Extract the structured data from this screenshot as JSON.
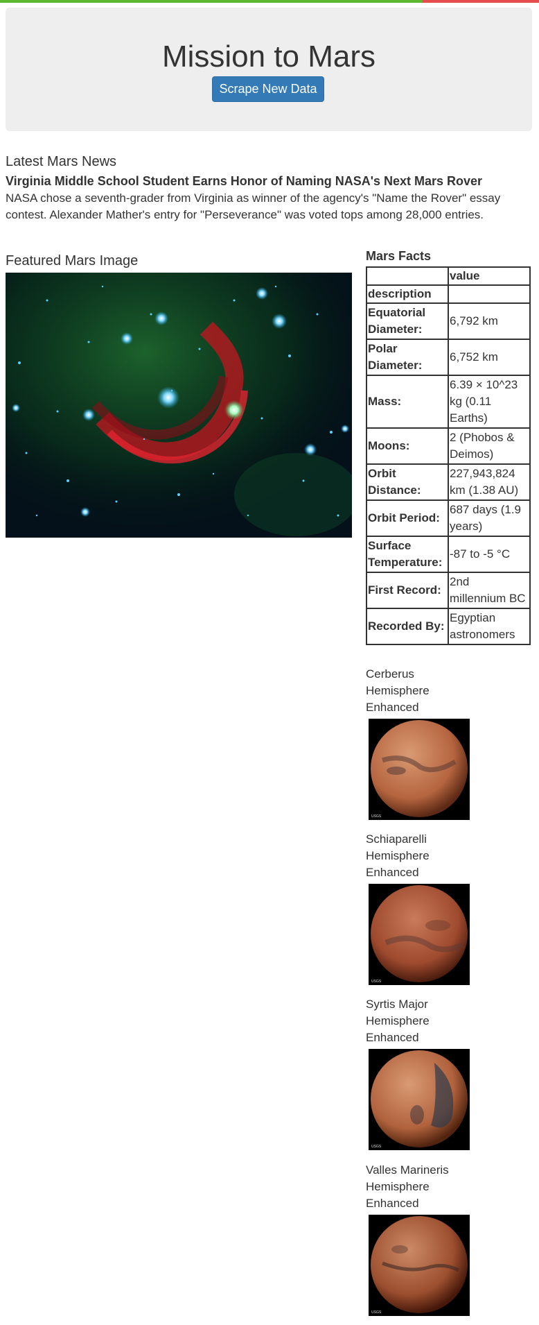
{
  "colors": {
    "top_bar_left": "#5cb82e",
    "top_bar_right": "#e74c4c",
    "jumbotron_bg": "#eeeeee",
    "button_bg": "#337ab7",
    "text": "#333333"
  },
  "header": {
    "title": "Mission to Mars",
    "scrape_button_label": "Scrape New Data"
  },
  "news": {
    "heading": "Latest Mars News",
    "title": "Virginia Middle School Student Earns Honor of Naming NASA's Next Mars Rover",
    "paragraph": "NASA chose a seventh-grader from Virginia as winner of the agency's \"Name the Rover\" essay contest. Alexander Mather's entry for \"Perseverance\" was voted tops among 28,000 entries."
  },
  "featured": {
    "heading": "Featured Mars Image"
  },
  "facts": {
    "heading": "Mars Facts",
    "column_header": "value",
    "index_label": "description",
    "rows": [
      {
        "label": "Equatorial Diameter:",
        "value": "6,792 km"
      },
      {
        "label": "Polar Diameter:",
        "value": "6,752 km"
      },
      {
        "label": "Mass:",
        "value": "6.39 × 10^23 kg (0.11 Earths)"
      },
      {
        "label": "Moons:",
        "value": "2 (Phobos & Deimos)"
      },
      {
        "label": "Orbit Distance:",
        "value": "227,943,824 km (1.38 AU)"
      },
      {
        "label": "Orbit Period:",
        "value": "687 days (1.9 years)"
      },
      {
        "label": "Surface Temperature:",
        "value": "-87 to -5 °C"
      },
      {
        "label": "First Record:",
        "value": "2nd millennium BC"
      },
      {
        "label": "Recorded By:",
        "value": "Egyptian astronomers"
      }
    ]
  },
  "hemispheres": [
    {
      "title": "Cerberus Hemisphere Enhanced"
    },
    {
      "title": "Schiaparelli Hemisphere Enhanced"
    },
    {
      "title": "Syrtis Major Hemisphere Enhanced"
    },
    {
      "title": "Valles Marineris Hemisphere Enhanced"
    }
  ]
}
